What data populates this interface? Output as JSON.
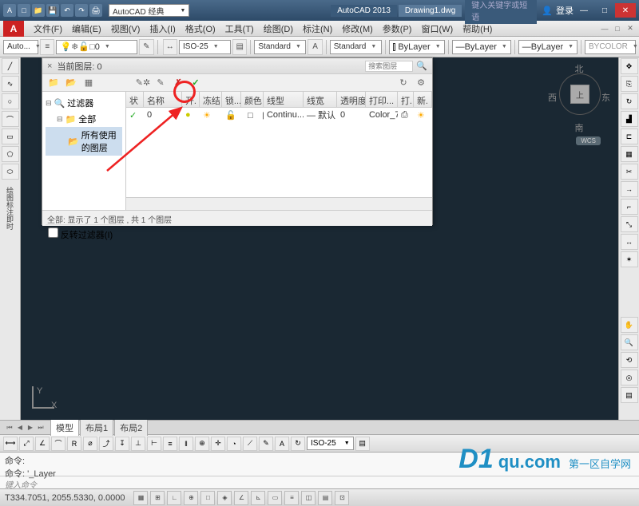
{
  "title": {
    "app": "AutoCAD 2013",
    "doc": "Drawing1.dwg",
    "workspace": "AutoCAD 经典",
    "search_placeholder": "键入关键字或短语",
    "signin": "登录"
  },
  "menu": [
    "文件(F)",
    "编辑(E)",
    "视图(V)",
    "插入(I)",
    "格式(O)",
    "工具(T)",
    "绘图(D)",
    "标注(N)",
    "修改(M)",
    "参数(P)",
    "窗口(W)",
    "帮助(H)"
  ],
  "toolbar2": {
    "layer_state": "Auto...",
    "layer_current": "0",
    "dimstyle": "ISO-25",
    "textstyle": "Standard",
    "tablestyle": "Standard",
    "color": "ByLayer",
    "linetype": "ByLayer",
    "lineweight": "ByLayer",
    "plotstyle": "BYCOLOR"
  },
  "dialog": {
    "title": "当前图层: 0",
    "search_placeholder": "搜索图层",
    "tree": {
      "root": "过滤器",
      "child": "全部",
      "leaf": "所有使用的图层"
    },
    "invert": "反转过滤器(I)",
    "cols": [
      "状",
      "名称",
      "开.",
      "冻结",
      "锁...",
      "颜色",
      "线型",
      "线宽",
      "透明度",
      "打印...",
      "打.",
      "新."
    ],
    "row": {
      "state": "✓",
      "name": "0",
      "on": "●",
      "freeze": "☀",
      "lock": "🔓",
      "color_icon": "□",
      "color": "白",
      "ltype": "Continu...",
      "lweight": "— 默认",
      "transp": "0",
      "plotstyle": "Color_7",
      "plot": "⎙",
      "new": "☀"
    },
    "status": "全部: 显示了 1 个图层 , 共 1 个图层"
  },
  "viewcube": {
    "n": "北",
    "s": "南",
    "e": "东",
    "w": "西",
    "top": "上",
    "wcs": "WCS"
  },
  "ucs": {
    "x": "X",
    "y": "Y"
  },
  "tabs": {
    "model": "模型",
    "layout1": "布局1",
    "layout2": "布局2"
  },
  "btoolbar": {
    "dimstyle": "ISO-25"
  },
  "cmd": {
    "label": "命令:",
    "last": "命令: '_Layer",
    "prompt": "键入命令"
  },
  "status": {
    "coords": "T334.7051, 2055.5330, 0.0000"
  },
  "watermark": {
    "brand": "D1",
    "suffix": "qu.com",
    "cn": "第一区自学网"
  }
}
